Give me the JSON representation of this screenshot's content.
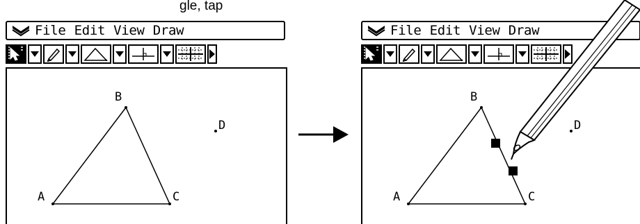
{
  "caption_fragment": "gle, tap",
  "screens": {
    "before": {
      "menu": [
        "File",
        "Edit",
        "View",
        "Draw"
      ],
      "points": {
        "A": "A",
        "B": "B",
        "C": "C",
        "D": "D"
      }
    },
    "after": {
      "menu": [
        "File",
        "Edit",
        "View",
        "Draw"
      ],
      "points": {
        "A": "A",
        "B": "B",
        "C": "C",
        "D": "D"
      }
    }
  },
  "icons": {
    "menu_logo": "double-chevron-down-icon",
    "select_tool": "pointer-select-icon",
    "sketch_tool": "pencil-icon",
    "shape_tool": "triangle-icon",
    "construct_tool": "perpendicular-icon",
    "grid_tool": "grid-icon",
    "more": "play-right-icon"
  },
  "colors": {
    "ink": "#000000",
    "background": "#ffffff"
  }
}
